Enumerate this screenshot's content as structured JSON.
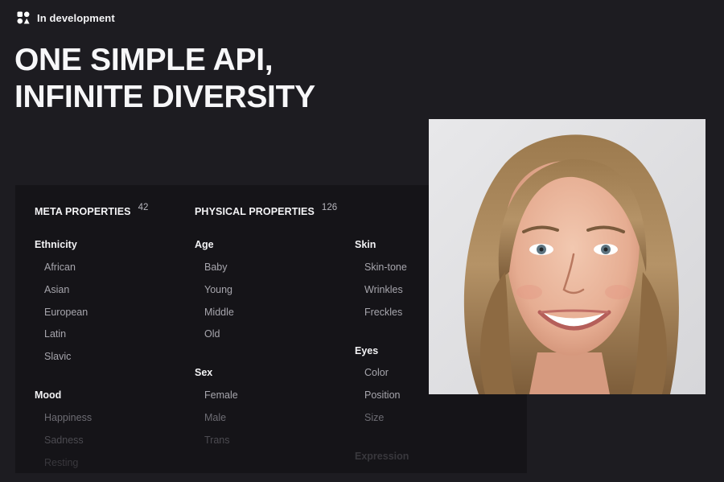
{
  "badge": {
    "text": "In development",
    "icon": "brand-shapes-icon"
  },
  "hero": {
    "line1": "ONE SIMPLE API,",
    "line2": "INFINITE DIVERSITY"
  },
  "meta": {
    "title": "META PROPERTIES",
    "count": "42",
    "ethnicity": {
      "title": "Ethnicity",
      "items": [
        "African",
        "Asian",
        "European",
        "Latin",
        "Slavic"
      ]
    },
    "mood": {
      "title": "Mood",
      "items": [
        "Happiness",
        "Sadness",
        "Resting"
      ]
    }
  },
  "physical": {
    "title": "PHYSICAL PROPERTIES",
    "count": "126",
    "age": {
      "title": "Age",
      "items": [
        "Baby",
        "Young",
        "Middle",
        "Old"
      ]
    },
    "sex": {
      "title": "Sex",
      "items": [
        "Female",
        "Male",
        "Trans"
      ]
    },
    "skin": {
      "title": "Skin",
      "items": [
        "Skin-tone",
        "Wrinkles",
        "Freckles"
      ]
    },
    "eyes": {
      "title": "Eyes",
      "items": [
        "Color",
        "Position",
        "Size"
      ]
    },
    "expression": {
      "title": "Expression"
    }
  },
  "colors": {
    "background": "#1d1c21",
    "panel": "#151418",
    "text": "#f4f4f6",
    "muted": "#a7a6ad"
  }
}
